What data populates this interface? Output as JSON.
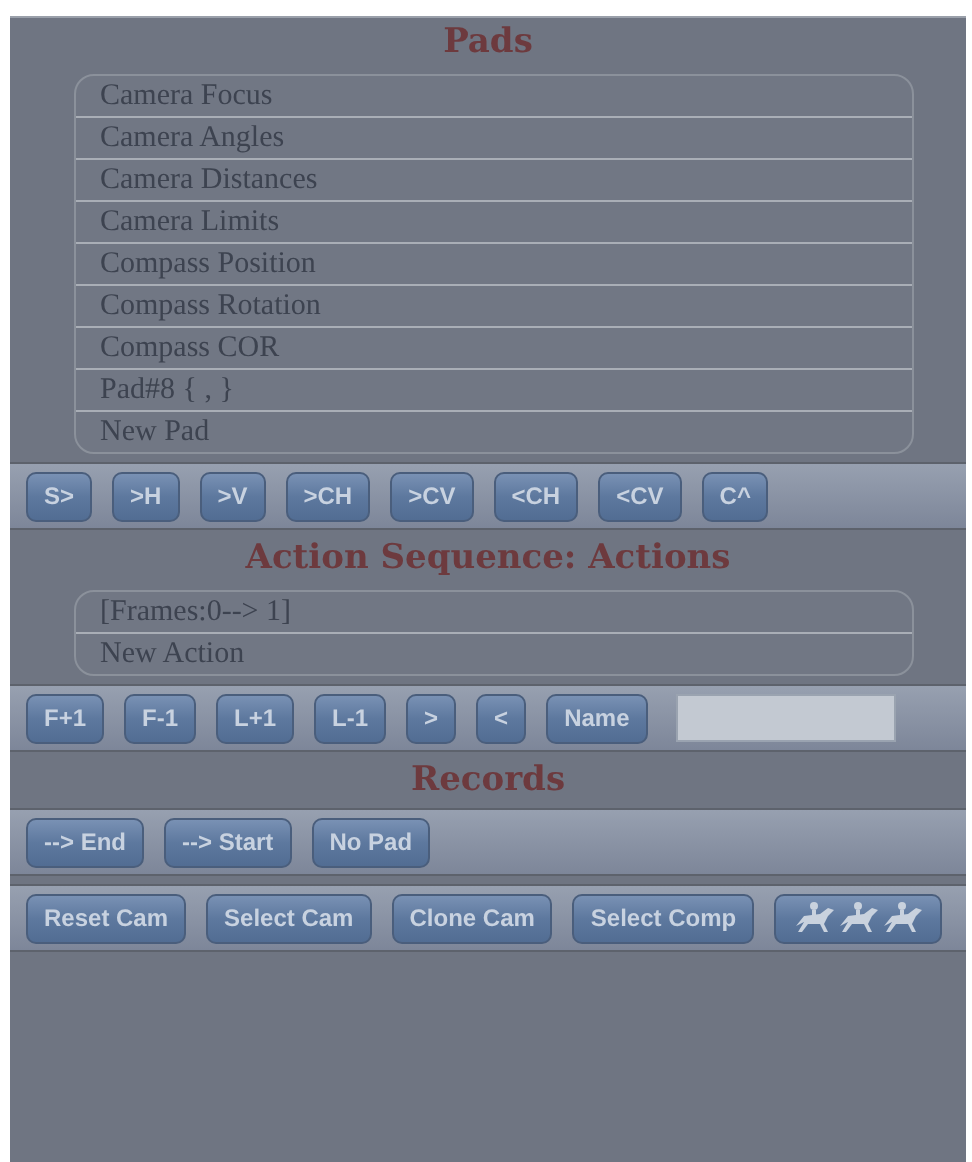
{
  "sections": [
    {
      "kind": "list",
      "title": "Pads",
      "items": [
        "Camera Focus",
        "Camera Angles",
        "Camera Distances",
        "Camera Limits",
        "Compass Position",
        "Compass Rotation",
        "Compass COR",
        "Pad#8 { , }",
        "New Pad"
      ]
    },
    {
      "kind": "toolbar",
      "items": [
        {
          "kind": "button",
          "label": "S>"
        },
        {
          "kind": "button",
          "label": ">H"
        },
        {
          "kind": "button",
          "label": ">V"
        },
        {
          "kind": "button",
          "label": ">CH"
        },
        {
          "kind": "button",
          "label": ">CV"
        },
        {
          "kind": "button",
          "label": "<CH"
        },
        {
          "kind": "button",
          "label": "<CV"
        },
        {
          "kind": "button",
          "label": "C^"
        }
      ]
    },
    {
      "kind": "list",
      "title": "Action Sequence: Actions",
      "items": [
        "[Frames:0--> 1]",
        "New Action"
      ]
    },
    {
      "kind": "toolbar",
      "items": [
        {
          "kind": "button",
          "label": "F+1"
        },
        {
          "kind": "button",
          "label": "F-1"
        },
        {
          "kind": "button",
          "label": "L+1"
        },
        {
          "kind": "button",
          "label": "L-1"
        },
        {
          "kind": "button",
          "label": ">"
        },
        {
          "kind": "button",
          "label": "<"
        },
        {
          "kind": "button",
          "label": "Name"
        },
        {
          "kind": "field"
        }
      ]
    },
    {
      "kind": "heading",
      "title": "Records"
    },
    {
      "kind": "toolbar",
      "items": [
        {
          "kind": "button",
          "label": "--> End"
        },
        {
          "kind": "button",
          "label": "--> Start"
        },
        {
          "kind": "button",
          "label": "No Pad"
        }
      ]
    },
    {
      "kind": "toolbar",
      "items": [
        {
          "kind": "button",
          "label": "Reset Cam"
        },
        {
          "kind": "button",
          "label": "Select Cam"
        },
        {
          "kind": "button",
          "label": "Clone Cam"
        },
        {
          "kind": "button",
          "label": "Select Comp"
        },
        {
          "kind": "icon"
        }
      ]
    }
  ]
}
